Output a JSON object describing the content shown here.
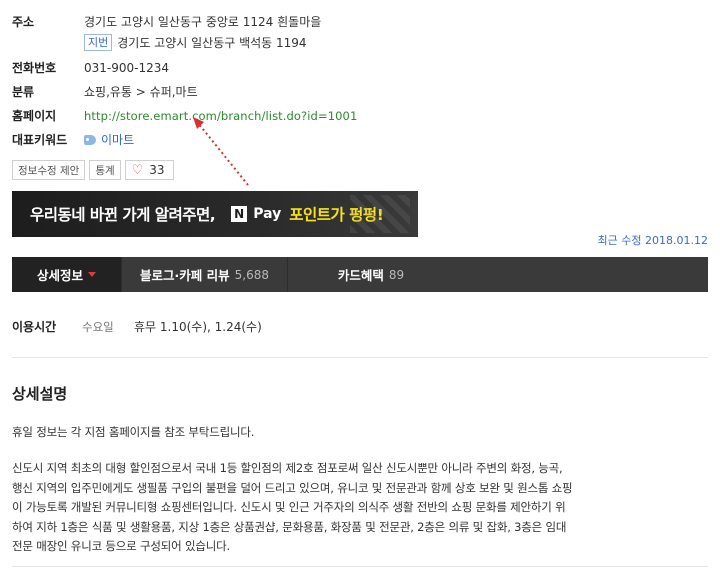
{
  "info": {
    "address_label": "주소",
    "address": "경기도 고양시 일산동구 중앙로 1124 흰돌마을",
    "jibun_badge": "지번",
    "jibun_address": "경기도 고양시 일산동구 백석동 1194",
    "phone_label": "전화번호",
    "phone": "031-900-1234",
    "category_label": "분류",
    "category": "쇼핑,유통 > 슈퍼,마트",
    "homepage_label": "홈페이지",
    "homepage": "http://store.emart.com/branch/list.do?id=1001",
    "keyword_label": "대표키워드",
    "keyword": "이마트",
    "keyword_icon": "tag-icon"
  },
  "actions": {
    "edit_label": "정보수정 제안",
    "stats_label": "통계",
    "like_icon": "heart-icon",
    "like_count": "33"
  },
  "banner": {
    "text": "우리동네 바뀐 가게 알려주면,",
    "npay_n": "N",
    "npay_label": "Pay",
    "point_text": "포인트가 펑펑!"
  },
  "last_update": "최근 수정 2018.01.12",
  "tabs": [
    {
      "label": "상세정보",
      "count": ""
    },
    {
      "label": "블로그·카페 리뷰",
      "count": "5,688"
    },
    {
      "label": "카드혜택",
      "count": "89"
    }
  ],
  "hours": {
    "label": "이용시간",
    "day": "수요일",
    "text": "휴무 1.10(수), 1.24(수)"
  },
  "details": {
    "title": "상세설명",
    "notice": "휴일 정보는 각 지점 홈페이지를 참조 부탁드립니다.",
    "lines": [
      "신도시 지역 최초의 대형 할인점으로서 국내 1등 할인점의 제2호 점포로써 일산 신도시뿐만 아니라 주변의 화정, 능곡,",
      "행신 지역의 입주민에게도 생필품 구입의 불편을 덜어 드리고 있으며, 유니코 및 전문관과 함께 상호 보완 및 원스톱 쇼핑",
      "이 가능토록 개발된 커뮤니티형 쇼핑센터입니다. 신도시 및 인근 거주자의 의식주 생활 전반의 쇼핑 문화를 제안하기 위",
      "하여 지하 1층은 식품 및 생활용품, 지상 1층은 상품권샵, 문화용품, 화장품 및 전문관, 2층은 의류 및 잡화, 3층은 임대",
      "전문 매장인 유니코 등으로 구성되어 있습니다."
    ]
  }
}
